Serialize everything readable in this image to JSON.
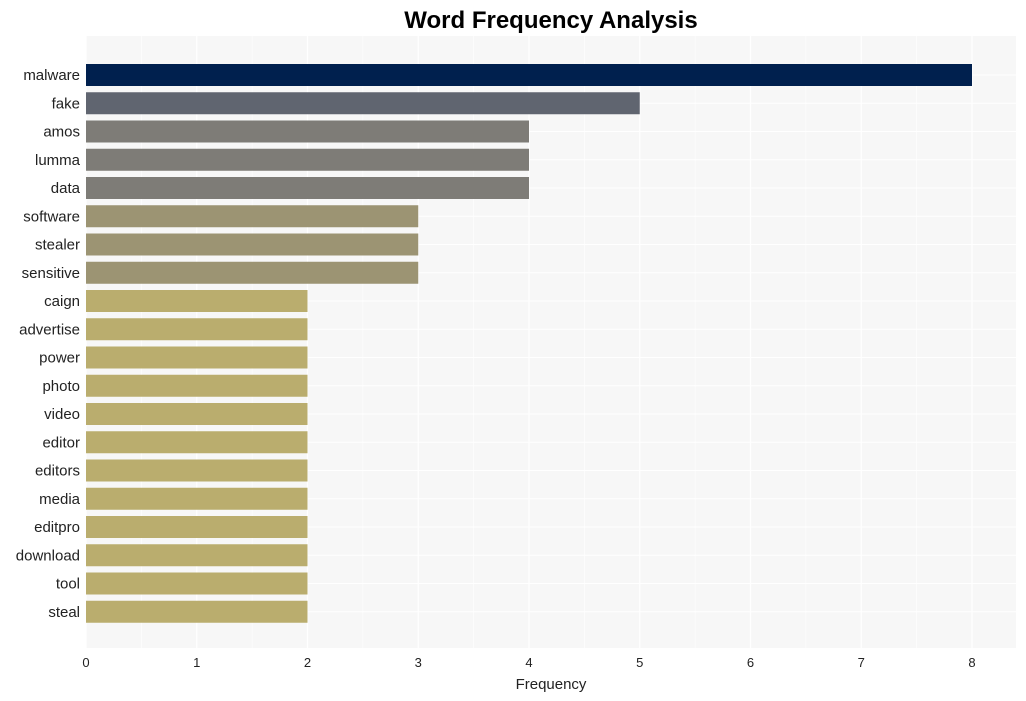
{
  "chart_data": {
    "type": "bar",
    "orientation": "horizontal",
    "title": "Word Frequency Analysis",
    "xlabel": "Frequency",
    "ylabel": "",
    "xlim": [
      0,
      8.4
    ],
    "xticks": [
      0,
      1,
      2,
      3,
      4,
      5,
      6,
      7,
      8
    ],
    "grid": true,
    "legend": "none",
    "categories": [
      "malware",
      "fake",
      "amos",
      "lumma",
      "data",
      "software",
      "stealer",
      "sensitive",
      "caign",
      "advertise",
      "power",
      "photo",
      "video",
      "editor",
      "editors",
      "media",
      "editpro",
      "download",
      "tool",
      "steal"
    ],
    "values": [
      8,
      5,
      4,
      4,
      4,
      3,
      3,
      3,
      2,
      2,
      2,
      2,
      2,
      2,
      2,
      2,
      2,
      2,
      2,
      2
    ],
    "colors": {
      "8": "#00204e",
      "5": "#606570",
      "4": "#7e7c77",
      "3": "#9c9473",
      "2": "#baad6e"
    },
    "plot_background": "#f7f7f7",
    "gridline_color": "#ffffff"
  }
}
